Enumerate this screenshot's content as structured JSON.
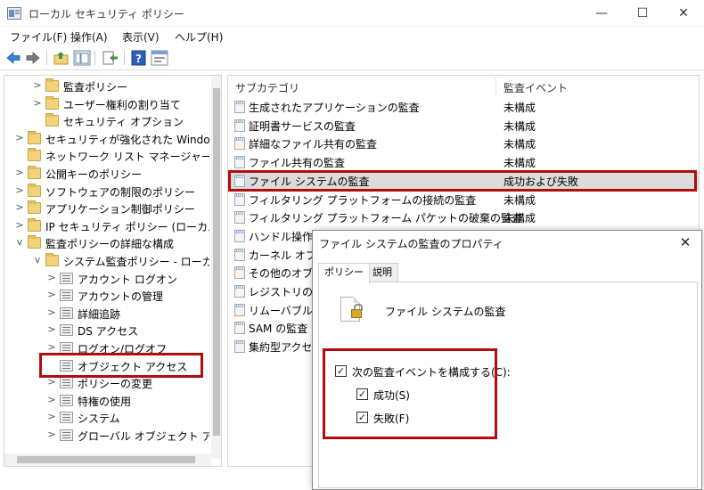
{
  "window": {
    "title": "ローカル セキュリティ ポリシー",
    "controls": {
      "minimize": "—",
      "maximize": "☐",
      "close": "✕"
    }
  },
  "menu": [
    "ファイル(F)",
    "操作(A)",
    "表示(V)",
    "ヘルプ(H)"
  ],
  "toolbar": {
    "buttons": [
      "back-icon",
      "forward-icon",
      "up-folder-icon",
      "show-hide-tree-icon",
      "export-list-icon",
      "help-icon",
      "properties-icon"
    ]
  },
  "tree": {
    "items": [
      {
        "label": "監査ポリシー",
        "icon": "audit-policy-icon",
        "level": 2,
        "expander": ">"
      },
      {
        "label": "ユーザー権利の割り当て",
        "icon": "folder-lock-icon",
        "level": 2,
        "expander": ">"
      },
      {
        "label": "セキュリティ オプション",
        "icon": "folder-lock-icon",
        "level": 2,
        "expander": ""
      },
      {
        "label": "セキュリティが強化された Windows",
        "icon": "folder-icon",
        "level": 1,
        "expander": ">"
      },
      {
        "label": "ネットワーク リスト マネージャー ポリシ",
        "icon": "folder-icon",
        "level": 1,
        "expander": ""
      },
      {
        "label": "公開キーのポリシー",
        "icon": "folder-icon",
        "level": 1,
        "expander": ">"
      },
      {
        "label": "ソフトウェアの制限のポリシー",
        "icon": "folder-icon",
        "level": 1,
        "expander": ">"
      },
      {
        "label": "アプリケーション制御ポリシー",
        "icon": "folder-icon",
        "level": 1,
        "expander": ">"
      },
      {
        "label": "IP セキュリティ ポリシー (ローカル コン",
        "icon": "ip-security-icon",
        "level": 1,
        "expander": ">"
      },
      {
        "label": "監査ポリシーの詳細な構成",
        "icon": "folder-icon",
        "level": 1,
        "expander": "v"
      },
      {
        "label": "システム監査ポリシー - ローカル ・",
        "icon": "system-audit-icon",
        "level": 2,
        "expander": "v"
      },
      {
        "label": "アカウント ログオン",
        "icon": "policy-icon",
        "level": 3,
        "expander": ">"
      },
      {
        "label": "アカウントの管理",
        "icon": "policy-icon",
        "level": 3,
        "expander": ">"
      },
      {
        "label": "詳細追跡",
        "icon": "policy-icon",
        "level": 3,
        "expander": ">"
      },
      {
        "label": "DS アクセス",
        "icon": "policy-icon",
        "level": 3,
        "expander": ">"
      },
      {
        "label": "ログオン/ログオフ",
        "icon": "policy-icon",
        "level": 3,
        "expander": ">"
      },
      {
        "label": "オブジェクト アクセス",
        "icon": "policy-icon",
        "level": 3,
        "expander": ""
      },
      {
        "label": "ポリシーの変更",
        "icon": "policy-icon",
        "level": 3,
        "expander": ">"
      },
      {
        "label": "特権の使用",
        "icon": "policy-icon",
        "level": 3,
        "expander": ">"
      },
      {
        "label": "システム",
        "icon": "policy-icon",
        "level": 3,
        "expander": ">"
      },
      {
        "label": "グローバル オブジェクト アクセ",
        "icon": "policy-icon",
        "level": 3,
        "expander": ">"
      }
    ]
  },
  "list": {
    "columns": [
      "サブカテゴリ",
      "監査イベント"
    ],
    "rows": [
      {
        "name": "生成されたアプリケーションの監査",
        "value": "未構成"
      },
      {
        "name": "証明書サービスの監査",
        "value": "未構成"
      },
      {
        "name": "詳細なファイル共有の監査",
        "value": "未構成"
      },
      {
        "name": "ファイル共有の監査",
        "value": "未構成"
      },
      {
        "name": "ファイル システムの監査",
        "value": "成功および失敗"
      },
      {
        "name": "フィルタリング プラットフォームの接続の監査",
        "value": "未構成"
      },
      {
        "name": "フィルタリング プラットフォーム パケットの破棄の監査",
        "value": "未構成"
      },
      {
        "name": "ハンドル操作の",
        "value": ""
      },
      {
        "name": "カーネル オブジ",
        "value": ""
      },
      {
        "name": "その他のオブジ",
        "value": ""
      },
      {
        "name": "レジストリの監",
        "value": ""
      },
      {
        "name": "リムーバブル記",
        "value": ""
      },
      {
        "name": "SAM の監査",
        "value": ""
      },
      {
        "name": "集約型アクセ",
        "value": ""
      }
    ],
    "icon_glyph": "101 010 101"
  },
  "dialog": {
    "title": "ファイル システムの監査のプロパティ",
    "close": "✕",
    "tabs": [
      "ポリシー",
      "説明"
    ],
    "policy_name": "ファイル システムの監査",
    "configure_label": "次の監査イベントを構成する(C):",
    "success_label": "成功(S)",
    "failure_label": "失敗(F)",
    "check_mark": "✓",
    "configure_checked": true,
    "success_checked": true,
    "failure_checked": true
  },
  "colors": {
    "highlight": "#b10d0d",
    "selected_row": "#dcdcdc"
  }
}
